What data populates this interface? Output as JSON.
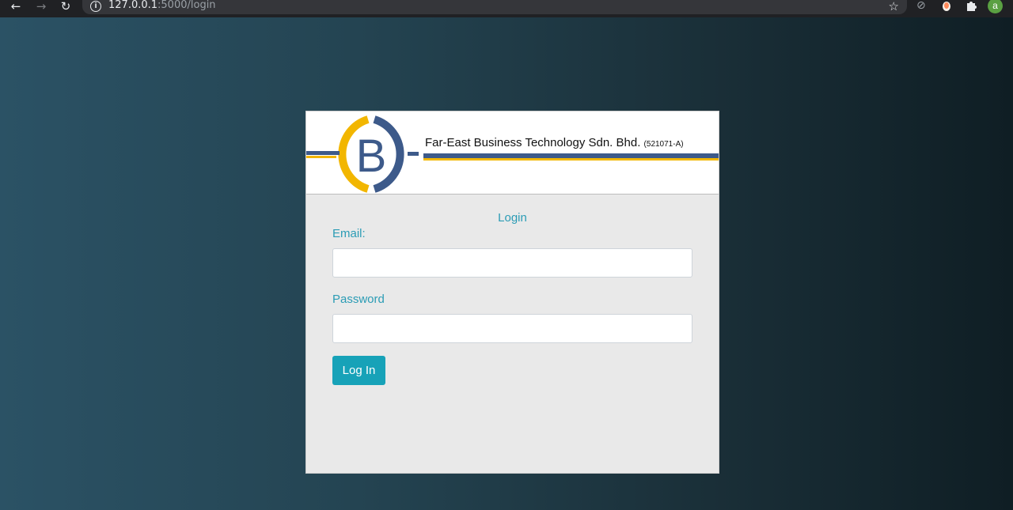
{
  "browser": {
    "back_icon": "arrow-left-icon",
    "forward_icon": "arrow-right-icon",
    "reload_icon": "reload-icon",
    "url_host": "127.0.0.1",
    "url_rest": ":5000/login",
    "avatar_letter": "a"
  },
  "banner": {
    "logo_letter": "B",
    "company_name": "Far-East Business Technology Sdn. Bhd.",
    "registration": "(521071-A)",
    "colors": {
      "blue": "#3d5a8a",
      "gold": "#f2b600"
    }
  },
  "login": {
    "title": "Login",
    "email_label": "Email:",
    "email_value": "",
    "password_label": "Password",
    "password_value": "",
    "submit_label": "Log In",
    "accent": "#17a2b8"
  }
}
